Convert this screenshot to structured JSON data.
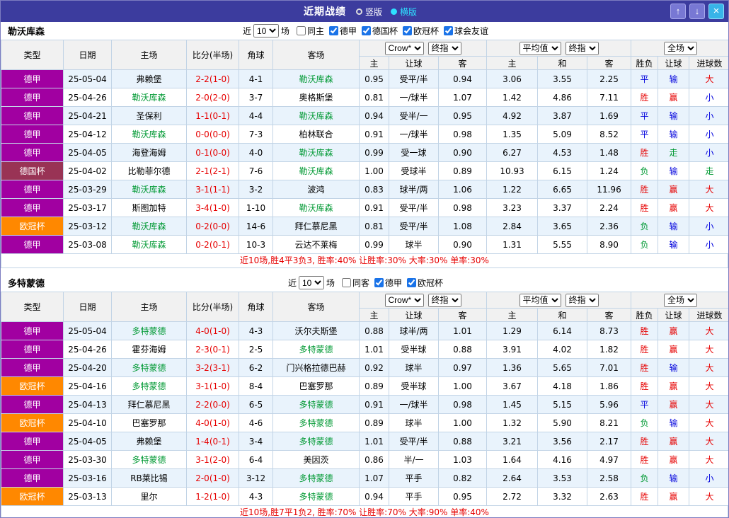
{
  "titlebar": {
    "title": "近期战绩",
    "layout_options": [
      {
        "label": "竖版",
        "selected": false
      },
      {
        "label": "横版",
        "selected": true
      }
    ],
    "up_glyph": "↑",
    "down_glyph": "↓",
    "close_glyph": "×"
  },
  "colors": {
    "titlebar_bg": "#3c3c9e",
    "selected_radio": "#2ee0ff",
    "self_team": "#009933",
    "score": "#e60000",
    "summary": "#e60000",
    "row_alt_bg": "#e9f3fc",
    "leagues": {
      "德甲": "#a100a1",
      "德国杯": "#993355",
      "欧冠杯": "#ff8800"
    },
    "results": {
      "胜": "#e60000",
      "赢": "#e60000",
      "大": "#e60000",
      "平": "#0000dd",
      "输": "#0000dd",
      "小": "#0000dd",
      "负": "#009933",
      "走": "#009933"
    }
  },
  "table_header": {
    "static_cols": [
      "类型",
      "日期",
      "主场",
      "比分(半场)",
      "角球",
      "客场"
    ],
    "groups": [
      {
        "dropdowns": [
          "Crow*",
          "终指"
        ],
        "cols": [
          "主",
          "让球",
          "客"
        ]
      },
      {
        "dropdowns": [
          "平均值",
          "终指"
        ],
        "cols": [
          "主",
          "和",
          "客"
        ]
      },
      {
        "dropdowns": [
          "全场"
        ],
        "cols": [
          "胜负",
          "让球",
          "进球数"
        ]
      }
    ]
  },
  "sections": [
    {
      "team": "勒沃库森",
      "filter": {
        "near_label": "近",
        "count": "10",
        "games_label": "场",
        "checkboxes": [
          {
            "label": "同主",
            "checked": false
          },
          {
            "label": "德甲",
            "checked": true
          },
          {
            "label": "德国杯",
            "checked": true
          },
          {
            "label": "欧冠杯",
            "checked": true
          },
          {
            "label": "球会友谊",
            "checked": true
          }
        ]
      },
      "rows": [
        {
          "league": "德甲",
          "date": "25-05-04",
          "home": "弗赖堡",
          "home_self": false,
          "score": "2-2(1-0)",
          "corners": "4-1",
          "away": "勒沃库森",
          "away_self": true,
          "ah": [
            "0.95",
            "受平/半",
            "0.94"
          ],
          "eu": [
            "3.06",
            "3.55",
            "2.25"
          ],
          "results": [
            "平",
            "输",
            "大"
          ]
        },
        {
          "league": "德甲",
          "date": "25-04-26",
          "home": "勒沃库森",
          "home_self": true,
          "score": "2-0(2-0)",
          "corners": "3-7",
          "away": "奥格斯堡",
          "away_self": false,
          "ah": [
            "0.81",
            "一/球半",
            "1.07"
          ],
          "eu": [
            "1.42",
            "4.86",
            "7.11"
          ],
          "results": [
            "胜",
            "赢",
            "小"
          ]
        },
        {
          "league": "德甲",
          "date": "25-04-21",
          "home": "圣保利",
          "home_self": false,
          "score": "1-1(0-1)",
          "corners": "4-4",
          "away": "勒沃库森",
          "away_self": true,
          "ah": [
            "0.94",
            "受半/一",
            "0.95"
          ],
          "eu": [
            "4.92",
            "3.87",
            "1.69"
          ],
          "results": [
            "平",
            "输",
            "小"
          ]
        },
        {
          "league": "德甲",
          "date": "25-04-12",
          "home": "勒沃库森",
          "home_self": true,
          "score": "0-0(0-0)",
          "corners": "7-3",
          "away": "柏林联合",
          "away_self": false,
          "ah": [
            "0.91",
            "一/球半",
            "0.98"
          ],
          "eu": [
            "1.35",
            "5.09",
            "8.52"
          ],
          "results": [
            "平",
            "输",
            "小"
          ]
        },
        {
          "league": "德甲",
          "date": "25-04-05",
          "home": "海登海姆",
          "home_self": false,
          "score": "0-1(0-0)",
          "corners": "4-0",
          "away": "勒沃库森",
          "away_self": true,
          "ah": [
            "0.99",
            "受一球",
            "0.90"
          ],
          "eu": [
            "6.27",
            "4.53",
            "1.48"
          ],
          "results": [
            "胜",
            "走",
            "小"
          ]
        },
        {
          "league": "德国杯",
          "date": "25-04-02",
          "home": "比勒菲尔德",
          "home_self": false,
          "score": "2-1(2-1)",
          "corners": "7-6",
          "away": "勒沃库森",
          "away_self": true,
          "ah": [
            "1.00",
            "受球半",
            "0.89"
          ],
          "eu": [
            "10.93",
            "6.15",
            "1.24"
          ],
          "results": [
            "负",
            "输",
            "走"
          ]
        },
        {
          "league": "德甲",
          "date": "25-03-29",
          "home": "勒沃库森",
          "home_self": true,
          "score": "3-1(1-1)",
          "corners": "3-2",
          "away": "波鸿",
          "away_self": false,
          "ah": [
            "0.83",
            "球半/两",
            "1.06"
          ],
          "eu": [
            "1.22",
            "6.65",
            "11.96"
          ],
          "results": [
            "胜",
            "赢",
            "大"
          ]
        },
        {
          "league": "德甲",
          "date": "25-03-17",
          "home": "斯图加特",
          "home_self": false,
          "score": "3-4(1-0)",
          "corners": "1-10",
          "away": "勒沃库森",
          "away_self": true,
          "ah": [
            "0.91",
            "受平/半",
            "0.98"
          ],
          "eu": [
            "3.23",
            "3.37",
            "2.24"
          ],
          "results": [
            "胜",
            "赢",
            "大"
          ]
        },
        {
          "league": "欧冠杯",
          "date": "25-03-12",
          "home": "勒沃库森",
          "home_self": true,
          "score": "0-2(0-0)",
          "corners": "14-6",
          "away": "拜仁慕尼黑",
          "away_self": false,
          "ah": [
            "0.81",
            "受平/半",
            "1.08"
          ],
          "eu": [
            "2.84",
            "3.65",
            "2.36"
          ],
          "results": [
            "负",
            "输",
            "小"
          ]
        },
        {
          "league": "德甲",
          "date": "25-03-08",
          "home": "勒沃库森",
          "home_self": true,
          "score": "0-2(0-1)",
          "corners": "10-3",
          "away": "云达不莱梅",
          "away_self": false,
          "ah": [
            "0.99",
            "球半",
            "0.90"
          ],
          "eu": [
            "1.31",
            "5.55",
            "8.90"
          ],
          "results": [
            "负",
            "输",
            "小"
          ]
        }
      ],
      "summary": "近10场,胜4平3负3, 胜率:40% 让胜率:30% 大率:30% 单率:30%"
    },
    {
      "team": "多特蒙德",
      "filter": {
        "near_label": "近",
        "count": "10",
        "games_label": "场",
        "checkboxes": [
          {
            "label": "同客",
            "checked": false
          },
          {
            "label": "德甲",
            "checked": true
          },
          {
            "label": "欧冠杯",
            "checked": true
          }
        ]
      },
      "rows": [
        {
          "league": "德甲",
          "date": "25-05-04",
          "home": "多特蒙德",
          "home_self": true,
          "score": "4-0(1-0)",
          "corners": "4-3",
          "away": "沃尔夫斯堡",
          "away_self": false,
          "ah": [
            "0.88",
            "球半/两",
            "1.01"
          ],
          "eu": [
            "1.29",
            "6.14",
            "8.73"
          ],
          "results": [
            "胜",
            "赢",
            "大"
          ]
        },
        {
          "league": "德甲",
          "date": "25-04-26",
          "home": "霍芬海姆",
          "home_self": false,
          "score": "2-3(0-1)",
          "corners": "2-5",
          "away": "多特蒙德",
          "away_self": true,
          "ah": [
            "1.01",
            "受半球",
            "0.88"
          ],
          "eu": [
            "3.91",
            "4.02",
            "1.82"
          ],
          "results": [
            "胜",
            "赢",
            "大"
          ]
        },
        {
          "league": "德甲",
          "date": "25-04-20",
          "home": "多特蒙德",
          "home_self": true,
          "score": "3-2(3-1)",
          "corners": "6-2",
          "away": "门兴格拉德巴赫",
          "away_self": false,
          "ah": [
            "0.92",
            "球半",
            "0.97"
          ],
          "eu": [
            "1.36",
            "5.65",
            "7.01"
          ],
          "results": [
            "胜",
            "输",
            "大"
          ]
        },
        {
          "league": "欧冠杯",
          "date": "25-04-16",
          "home": "多特蒙德",
          "home_self": true,
          "score": "3-1(1-0)",
          "corners": "8-4",
          "away": "巴塞罗那",
          "away_self": false,
          "ah": [
            "0.89",
            "受半球",
            "1.00"
          ],
          "eu": [
            "3.67",
            "4.18",
            "1.86"
          ],
          "results": [
            "胜",
            "赢",
            "大"
          ]
        },
        {
          "league": "德甲",
          "date": "25-04-13",
          "home": "拜仁慕尼黑",
          "home_self": false,
          "score": "2-2(0-0)",
          "corners": "6-5",
          "away": "多特蒙德",
          "away_self": true,
          "ah": [
            "0.91",
            "一/球半",
            "0.98"
          ],
          "eu": [
            "1.45",
            "5.15",
            "5.96"
          ],
          "results": [
            "平",
            "赢",
            "大"
          ]
        },
        {
          "league": "欧冠杯",
          "date": "25-04-10",
          "home": "巴塞罗那",
          "home_self": false,
          "score": "4-0(1-0)",
          "corners": "4-6",
          "away": "多特蒙德",
          "away_self": true,
          "ah": [
            "0.89",
            "球半",
            "1.00"
          ],
          "eu": [
            "1.32",
            "5.90",
            "8.21"
          ],
          "results": [
            "负",
            "输",
            "大"
          ]
        },
        {
          "league": "德甲",
          "date": "25-04-05",
          "home": "弗赖堡",
          "home_self": false,
          "score": "1-4(0-1)",
          "corners": "3-4",
          "away": "多特蒙德",
          "away_self": true,
          "ah": [
            "1.01",
            "受平/半",
            "0.88"
          ],
          "eu": [
            "3.21",
            "3.56",
            "2.17"
          ],
          "results": [
            "胜",
            "赢",
            "大"
          ]
        },
        {
          "league": "德甲",
          "date": "25-03-30",
          "home": "多特蒙德",
          "home_self": true,
          "score": "3-1(2-0)",
          "corners": "6-4",
          "away": "美因茨",
          "away_self": false,
          "ah": [
            "0.86",
            "半/一",
            "1.03"
          ],
          "eu": [
            "1.64",
            "4.16",
            "4.97"
          ],
          "results": [
            "胜",
            "赢",
            "大"
          ]
        },
        {
          "league": "德甲",
          "date": "25-03-16",
          "home": "RB莱比锡",
          "home_self": false,
          "score": "2-0(1-0)",
          "corners": "3-12",
          "away": "多特蒙德",
          "away_self": true,
          "ah": [
            "1.07",
            "平手",
            "0.82"
          ],
          "eu": [
            "2.64",
            "3.53",
            "2.58"
          ],
          "results": [
            "负",
            "输",
            "小"
          ]
        },
        {
          "league": "欧冠杯",
          "date": "25-03-13",
          "home": "里尔",
          "home_self": false,
          "score": "1-2(1-0)",
          "corners": "4-3",
          "away": "多特蒙德",
          "away_self": true,
          "ah": [
            "0.94",
            "平手",
            "0.95"
          ],
          "eu": [
            "2.72",
            "3.32",
            "2.63"
          ],
          "results": [
            "胜",
            "赢",
            "大"
          ]
        }
      ],
      "summary": "近10场,胜7平1负2, 胜率:70% 让胜率:70% 大率:90% 单率:40%"
    }
  ]
}
